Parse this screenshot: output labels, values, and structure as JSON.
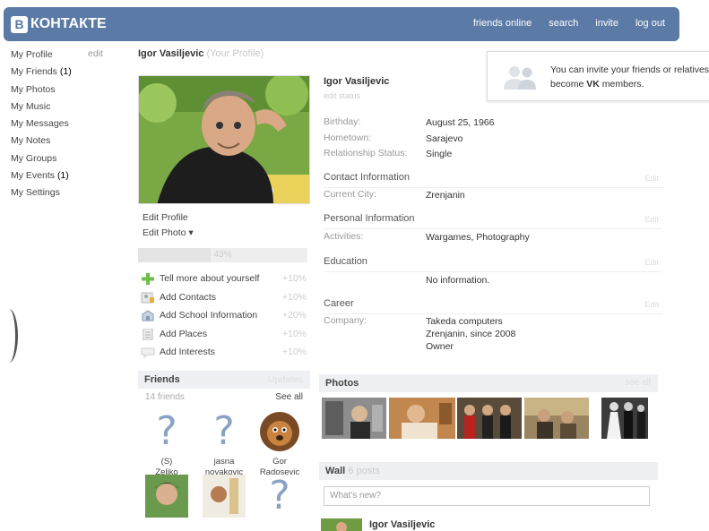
{
  "topbar": {
    "logo_letter": "B",
    "logo": "КОНТАКТЕ",
    "nav": [
      "friends online",
      "search",
      "invite",
      "log out"
    ]
  },
  "leftnav": {
    "items": [
      {
        "label": "My Profile",
        "count": ""
      },
      {
        "label": "My Friends",
        "count": "(1)"
      },
      {
        "label": "My Photos",
        "count": ""
      },
      {
        "label": "My Music",
        "count": ""
      },
      {
        "label": "My Messages",
        "count": ""
      },
      {
        "label": "My Notes",
        "count": ""
      },
      {
        "label": "My Groups",
        "count": ""
      },
      {
        "label": "My Events",
        "count": "(1)"
      },
      {
        "label": "My Settings",
        "count": ""
      }
    ],
    "edit": "edit"
  },
  "header": {
    "name": "Igor Vasiljevic",
    "sub": "(Your Profile)"
  },
  "invite": {
    "line1": "You can invite your friends or relatives",
    "line2_prefix": "become ",
    "line2_bold": "VK",
    "line2_suffix": " members."
  },
  "profile": {
    "edit_profile": "Edit Profile",
    "edit_photo": "Edit Photo ▾",
    "completion_percent": 43,
    "completion_label": "43%",
    "tasks": [
      {
        "label": "Tell more about yourself",
        "points": "+10%",
        "icon": "plus-icon"
      },
      {
        "label": "Add Contacts",
        "points": "+10%",
        "icon": "contacts-icon"
      },
      {
        "label": "Add School Information",
        "points": "+20%",
        "icon": "school-icon"
      },
      {
        "label": "Add Places",
        "points": "+10%",
        "icon": "places-icon"
      },
      {
        "label": "Add Interests",
        "points": "+10%",
        "icon": "interests-icon"
      }
    ]
  },
  "friends": {
    "title": "Friends",
    "updates": "Updates",
    "count": "14 friends",
    "see_all": "See all",
    "list": [
      {
        "line1": "(S)",
        "line2": "Zeljko"
      },
      {
        "line1": "jasna",
        "line2": "novakovic"
      },
      {
        "line1": "Gor",
        "line2": "Radosevic"
      }
    ]
  },
  "info": {
    "name": "Igor Vasiljevic",
    "edit_status": "edit status",
    "basic": [
      {
        "key": "Birthday:",
        "value": "August 25, 1966"
      },
      {
        "key": "Hometown:",
        "value": "Sarajevo"
      },
      {
        "key": "Relationship Status:",
        "value": "Single"
      }
    ],
    "contact_title": "Contact Information",
    "contact": [
      {
        "key": "Current City:",
        "value": "Zrenjanin"
      }
    ],
    "personal_title": "Personal Information",
    "personal": [
      {
        "key": "Activities:",
        "value": "Wargames, Photography"
      }
    ],
    "education_title": "Education",
    "education_value": "No information.",
    "career_title": "Career",
    "career_key": "Company:",
    "career_lines": [
      "Takeda computers",
      "Zrenjanin, since 2008",
      "Owner"
    ],
    "edit": "Edit"
  },
  "photos": {
    "title": "Photos",
    "see_all": "see all"
  },
  "wall": {
    "title": "Wall",
    "count": "6 posts",
    "placeholder": "What's new?",
    "post_author": "Igor Vasiljevic"
  }
}
